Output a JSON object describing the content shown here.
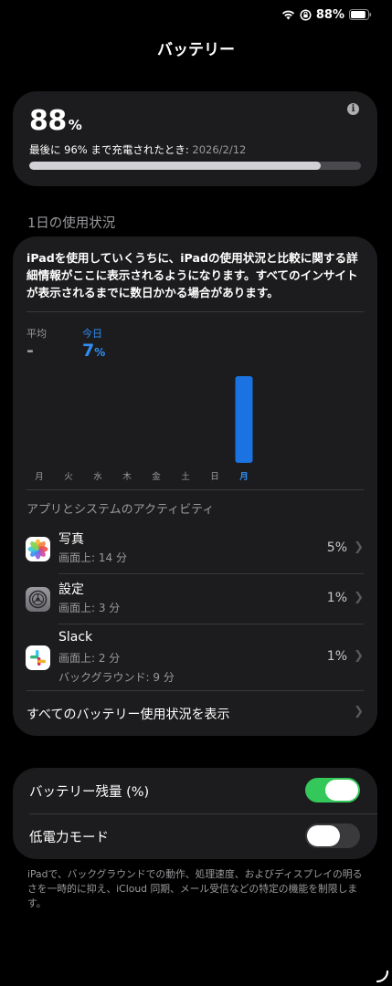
{
  "status_bar": {
    "battery_percent": "88%",
    "battery_level": 0.88
  },
  "title": "バッテリー",
  "battery": {
    "percent": "88",
    "percent_unit": "%",
    "last_charged_prefix": "最後に 96% まで充電されたとき: ",
    "last_charged_date": "2026/2/12",
    "level": 0.88
  },
  "daily_usage_label": "1日の使用状況",
  "usage": {
    "message": "iPadを使用していくうちに、iPadの使用状況と比較に関する詳細情報がここに表示されるようになります。すべてのインサイトが表示されるまでに数日かかる場合があります。",
    "average_label": "平均",
    "average_value": "-",
    "today_label": "今日",
    "today_value": "7",
    "today_unit": "%"
  },
  "chart_data": {
    "type": "bar",
    "categories": [
      "月",
      "火",
      "水",
      "木",
      "金",
      "土",
      "日",
      "月"
    ],
    "values": [
      0,
      0,
      0,
      0,
      0,
      0,
      0,
      7
    ],
    "highlight_index": 7,
    "ylim": [
      0,
      7
    ],
    "grid": false,
    "colors": {
      "bar": "#1a73e0",
      "label": "#9a9a9e",
      "active_label": "#2f8ef5"
    }
  },
  "activity": {
    "title": "アプリとシステムのアクティビティ",
    "apps": [
      {
        "name": "写真",
        "icon": "photos-icon",
        "lines": [
          "画面上: 14 分"
        ],
        "percent": "5%"
      },
      {
        "name": "設定",
        "icon": "settings-gear-icon",
        "lines": [
          "画面上: 3 分"
        ],
        "percent": "1%"
      },
      {
        "name": "Slack",
        "icon": "slack-icon",
        "lines": [
          "画面上: 2 分",
          "バックグラウンド: 9 分"
        ],
        "percent": "1%"
      }
    ],
    "show_all": "すべてのバッテリー使用状況を表示"
  },
  "toggles": [
    {
      "label": "バッテリー残量 (%)",
      "on": true
    },
    {
      "label": "低電力モード",
      "on": false
    }
  ],
  "footnote": "iPadで、バックグラウンドでの動作、処理速度、およびディスプレイの明るさを一時的に抑え、iCloud 同期、メール受信などの特定の機能を制限します。",
  "colors": {
    "accent": "#2f8ef5",
    "switch_on": "#34c759",
    "card": "#1c1c1e"
  }
}
